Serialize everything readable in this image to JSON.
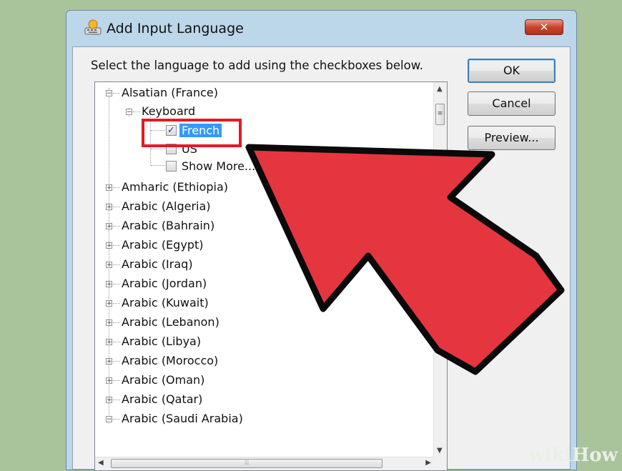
{
  "window": {
    "title": "Add Input Language",
    "close_label": "✕"
  },
  "instruction": "Select the language to add using the checkboxes below.",
  "tree": {
    "root_expanded": "Alsatian (France)",
    "keyboard_label": "Keyboard",
    "options": [
      {
        "label": "French",
        "checked": true,
        "selected": true
      },
      {
        "label": "US",
        "checked": false
      },
      {
        "label": "Show More...",
        "checked": false
      }
    ],
    "languages": [
      "Amharic (Ethiopia)",
      "Arabic (Algeria)",
      "Arabic (Bahrain)",
      "Arabic (Egypt)",
      "Arabic (Iraq)",
      "Arabic (Jordan)",
      "Arabic (Kuwait)",
      "Arabic (Lebanon)",
      "Arabic (Libya)",
      "Arabic (Morocco)",
      "Arabic (Oman)",
      "Arabic (Qatar)",
      "Arabic (Saudi Arabia)"
    ]
  },
  "buttons": {
    "ok": "OK",
    "cancel": "Cancel",
    "preview": "Preview..."
  },
  "watermark": "wikiHow",
  "colors": {
    "arrow": "#e5363f",
    "highlight_box": "#e01b24",
    "selection": "#3399ff"
  }
}
